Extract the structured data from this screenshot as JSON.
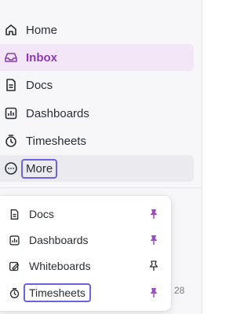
{
  "nav": {
    "items": [
      {
        "label": "Home",
        "icon": "home-icon"
      },
      {
        "label": "Inbox",
        "icon": "inbox-icon"
      },
      {
        "label": "Docs",
        "icon": "docs-icon"
      },
      {
        "label": "Dashboards",
        "icon": "dashboards-icon"
      },
      {
        "label": "Timesheets",
        "icon": "timesheets-icon"
      },
      {
        "label": "More",
        "icon": "more-icon"
      }
    ]
  },
  "more_menu": {
    "items": [
      {
        "label": "Docs",
        "icon": "docs-icon",
        "pinned": true
      },
      {
        "label": "Dashboards",
        "icon": "dashboards-icon",
        "pinned": true
      },
      {
        "label": "Whiteboards",
        "icon": "whiteboards-icon",
        "pinned": false
      },
      {
        "label": "Timesheets",
        "icon": "timesheets-icon",
        "pinned": true
      }
    ]
  },
  "background_number": "28",
  "colors": {
    "accent_purple": "#8d3bb3",
    "active_bg": "#f2e6f7",
    "highlight_border": "#6c63e0",
    "pin_filled": "#9b4fc0"
  }
}
